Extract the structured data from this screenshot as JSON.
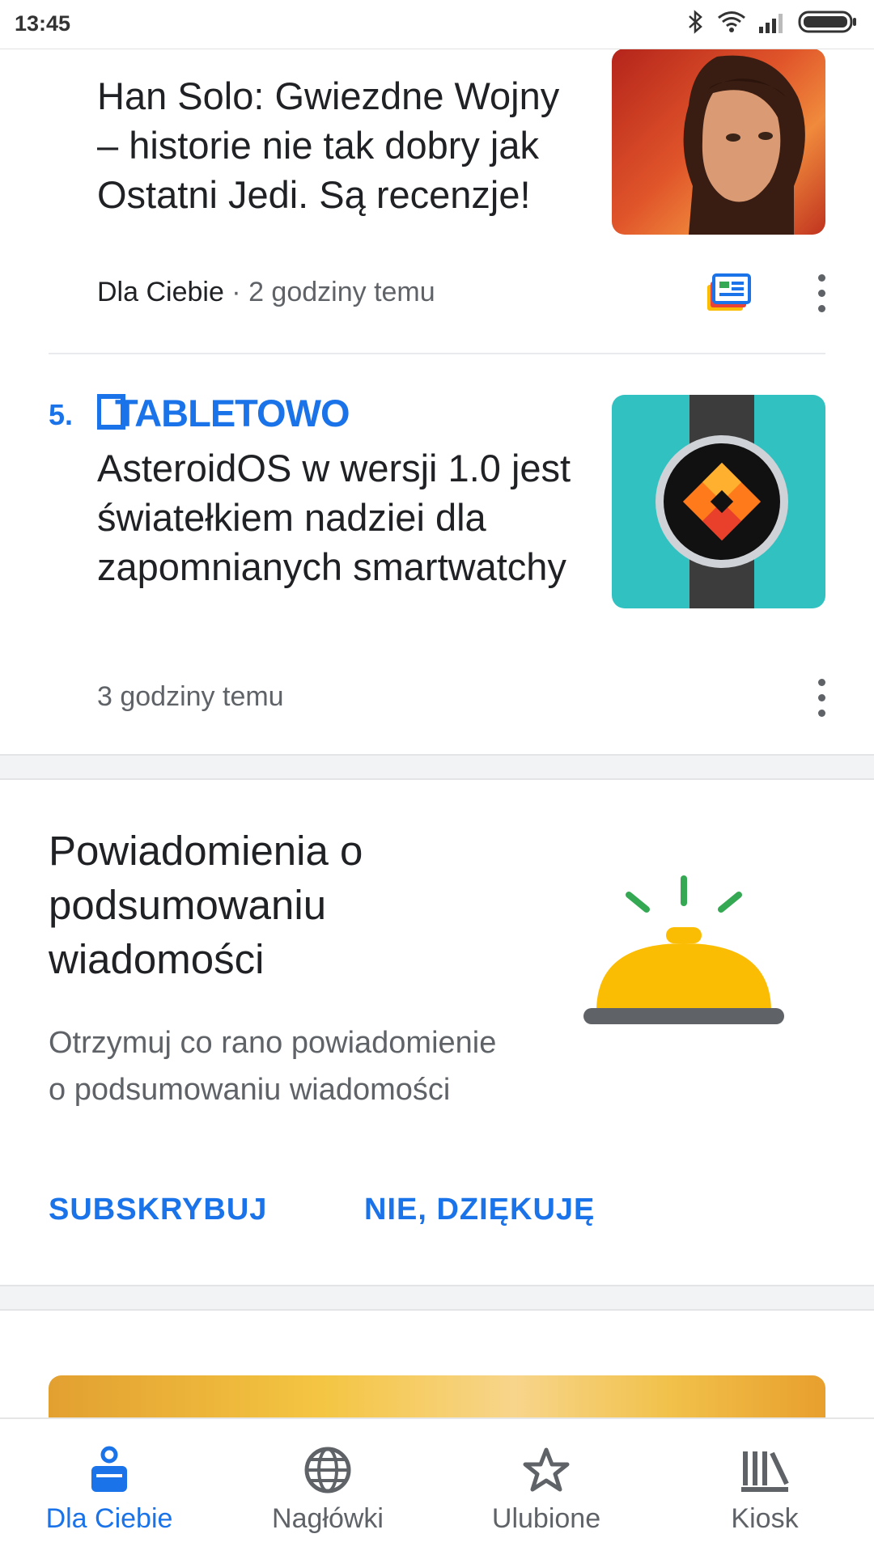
{
  "status": {
    "time": "13:45"
  },
  "articles": [
    {
      "title": "Han Solo: Gwiezdne Wojny – historie nie tak dobry jak Ostatni Jedi. Są recenzje!",
      "source_label": "Dla Ciebie",
      "separator": " · ",
      "time": "2 godziny temu"
    },
    {
      "rank": "5.",
      "publisher": "TABLETOWO",
      "title": "AsteroidOS w wersji 1.0 jest światełkiem nadziei dla zapomnianych smartwatchy",
      "time": "3 godziny temu"
    }
  ],
  "promo": {
    "title": "Powiadomienia o podsumowaniu wiadomości",
    "body": "Otrzymuj co rano powiadomienie o podsumowaniu wiadomości",
    "subscribe_label": "SUBSKRYBUJ",
    "decline_label": "NIE, DZIĘKUJĘ"
  },
  "bottom_nav": {
    "items": [
      {
        "label": "Dla Ciebie",
        "icon": "for-you-icon",
        "active": true
      },
      {
        "label": "Nagłówki",
        "icon": "globe-icon",
        "active": false
      },
      {
        "label": "Ulubione",
        "icon": "star-icon",
        "active": false
      },
      {
        "label": "Kiosk",
        "icon": "newsstand-icon",
        "active": false
      }
    ]
  },
  "colors": {
    "accent": "#1a73e8",
    "text": "#202124",
    "secondary": "#5f6368",
    "bell": "#fbbc04"
  }
}
